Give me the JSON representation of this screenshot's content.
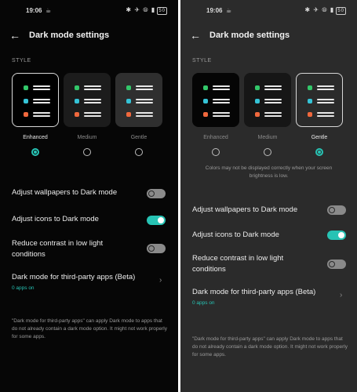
{
  "status": {
    "time": "19:06",
    "battery": "50",
    "icons": "✱ ✈ ⦾ ▮"
  },
  "header": {
    "title": "Dark mode settings",
    "back_glyph": "←"
  },
  "style_label": "STYLE",
  "style_options": [
    "Enhanced",
    "Medium",
    "Gentle"
  ],
  "note": "Colors may not be displayed correctly when your screen brightness is low.",
  "settings": {
    "wallpapers": "Adjust wallpapers to Dark mode",
    "icons": "Adjust icons to Dark mode",
    "contrast": "Reduce contrast in low light conditions",
    "third_party": "Dark mode for third-party apps (Beta)",
    "apps_on": "0 apps on"
  },
  "footer": "\"Dark mode for third-party apps\" can apply Dark mode to apps that do not already contain a dark mode option. It might not work properly for some apps.",
  "colors": {
    "accent": "#27c3b4",
    "green": "#33c76a",
    "cyan": "#35c3d6",
    "orange": "#f0683d"
  },
  "screens": [
    {
      "id": "left",
      "selected_style": "Enhanced",
      "wallpapers_on": false,
      "icons_on": true,
      "contrast_on": false
    },
    {
      "id": "right",
      "selected_style": "Gentle",
      "wallpapers_on": false,
      "icons_on": true,
      "contrast_on": false
    }
  ]
}
